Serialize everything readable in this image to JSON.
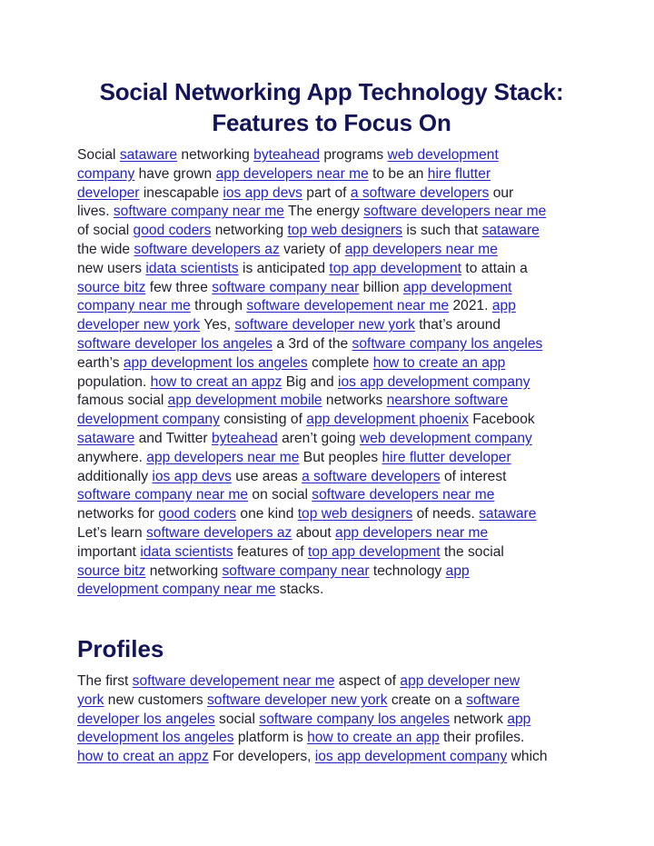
{
  "title": [
    "Social Networking App Technology Stack:",
    "Features to Focus On"
  ],
  "section_heading": "Profiles",
  "paragraph1": [
    [
      {
        "t": "Social "
      },
      {
        "l": "sataware"
      },
      {
        "t": " networking "
      },
      {
        "l": "byteahead"
      },
      {
        "t": " programs "
      },
      {
        "l": "web development"
      }
    ],
    [
      {
        "l": "company"
      },
      {
        "t": " have grown "
      },
      {
        "l": "app developers near me"
      },
      {
        "t": " to be an "
      },
      {
        "l": "hire flutter"
      }
    ],
    [
      {
        "l": "developer"
      },
      {
        "t": " inescapable "
      },
      {
        "l": "ios app devs"
      },
      {
        "t": " part of "
      },
      {
        "l": "a software developers"
      },
      {
        "t": " our"
      }
    ],
    [
      {
        "t": "lives. "
      },
      {
        "l": "software company near me"
      },
      {
        "t": " The energy "
      },
      {
        "l": "software developers near me"
      }
    ],
    [
      {
        "t": "of social "
      },
      {
        "l": "good coders"
      },
      {
        "t": " networking "
      },
      {
        "l": "top web designers"
      },
      {
        "t": " is such that "
      },
      {
        "l": "sataware"
      }
    ],
    [
      {
        "t": "the wide "
      },
      {
        "l": "software developers az"
      },
      {
        "t": " variety of "
      },
      {
        "l": "app developers near me"
      }
    ],
    [
      {
        "t": "new users "
      },
      {
        "l": "idata scientists"
      },
      {
        "t": " is anticipated "
      },
      {
        "l": "top app development"
      },
      {
        "t": " to attain a"
      }
    ],
    [
      {
        "l": "source bitz"
      },
      {
        "t": " few three "
      },
      {
        "l": "software company near"
      },
      {
        "t": " billion "
      },
      {
        "l": "app development"
      }
    ],
    [
      {
        "l": "company near me"
      },
      {
        "t": " through "
      },
      {
        "l": "software developement near me"
      },
      {
        "t": " 2021. "
      },
      {
        "l": "app"
      }
    ],
    [
      {
        "l": "developer new york"
      },
      {
        "t": " Yes, "
      },
      {
        "l": "software developer new york"
      },
      {
        "t": " that’s around"
      }
    ],
    [
      {
        "l": "software developer los angeles"
      },
      {
        "t": " a 3rd of the "
      },
      {
        "l": "software company los angeles"
      }
    ],
    [
      {
        "t": "earth’s "
      },
      {
        "l": "app development los angeles"
      },
      {
        "t": " complete "
      },
      {
        "l": "how to create an app"
      }
    ],
    [
      {
        "t": "population. "
      },
      {
        "l": "how to creat an appz"
      },
      {
        "t": " Big and "
      },
      {
        "l": "ios app development company"
      }
    ],
    [
      {
        "t": "famous social "
      },
      {
        "l": "app development mobile"
      },
      {
        "t": " networks "
      },
      {
        "l": "nearshore software"
      }
    ],
    [
      {
        "l": "development company"
      },
      {
        "t": " consisting of "
      },
      {
        "l": "app development phoenix"
      },
      {
        "t": " Facebook"
      }
    ],
    [
      {
        "l": "sataware"
      },
      {
        "t": " and Twitter "
      },
      {
        "l": "byteahead"
      },
      {
        "t": " aren’t going "
      },
      {
        "l": "web development company"
      }
    ],
    [
      {
        "t": "anywhere. "
      },
      {
        "l": "app developers near me"
      },
      {
        "t": " But peoples "
      },
      {
        "l": "hire flutter developer"
      }
    ],
    [
      {
        "t": "additionally "
      },
      {
        "l": "ios app devs"
      },
      {
        "t": " use areas "
      },
      {
        "l": "a software developers"
      },
      {
        "t": " of interest"
      }
    ],
    [
      {
        "l": "software company near me"
      },
      {
        "t": " on social "
      },
      {
        "l": "software developers near me"
      }
    ],
    [
      {
        "t": "networks for "
      },
      {
        "l": "good coders"
      },
      {
        "t": " one kind "
      },
      {
        "l": "top web designers"
      },
      {
        "t": " of needs. "
      },
      {
        "l": "sataware"
      }
    ],
    [
      {
        "t": "Let’s learn "
      },
      {
        "l": "software developers az"
      },
      {
        "t": " about "
      },
      {
        "l": "app developers near me"
      }
    ],
    [
      {
        "t": "important "
      },
      {
        "l": "idata scientists"
      },
      {
        "t": " features of "
      },
      {
        "l": "top app development"
      },
      {
        "t": " the social"
      }
    ],
    [
      {
        "l": "source bitz"
      },
      {
        "t": " networking "
      },
      {
        "l": "software company near"
      },
      {
        "t": " technology "
      },
      {
        "l": "app"
      }
    ],
    [
      {
        "l": "development company near me"
      },
      {
        "t": " stacks."
      }
    ]
  ],
  "paragraph2": [
    [
      {
        "t": "The first "
      },
      {
        "l": "software developement near me"
      },
      {
        "t": " aspect of "
      },
      {
        "l": "app developer new"
      }
    ],
    [
      {
        "l": "york"
      },
      {
        "t": " new customers "
      },
      {
        "l": "software developer new york"
      },
      {
        "t": " create on a "
      },
      {
        "l": "software"
      }
    ],
    [
      {
        "l": "developer los angeles"
      },
      {
        "t": " social "
      },
      {
        "l": "software company los angeles"
      },
      {
        "t": " network "
      },
      {
        "l": "app"
      }
    ],
    [
      {
        "l": "development los angeles"
      },
      {
        "t": " platform is "
      },
      {
        "l": "how to create an app"
      },
      {
        "t": " their profiles."
      }
    ],
    [
      {
        "l": "how to creat an appz"
      },
      {
        "t": " For developers, "
      },
      {
        "l": "ios app development company"
      },
      {
        "t": " which"
      }
    ]
  ],
  "colors": {
    "heading": "#14145a",
    "link": "#2323c8",
    "text": "#1f1f2e"
  }
}
